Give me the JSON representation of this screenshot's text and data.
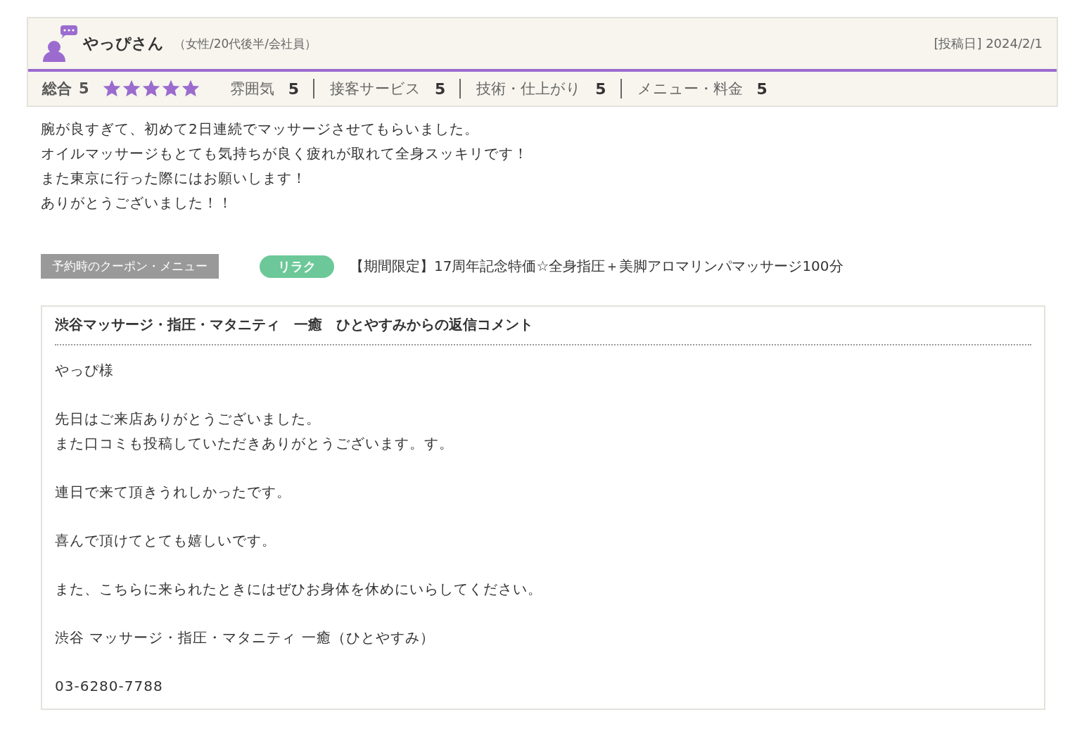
{
  "reviewer": {
    "name": "やっぴさん",
    "profile": "（女性/20代後半/会社員）",
    "posted": "[投稿日] 2024/2/1"
  },
  "overall": {
    "label": "総合",
    "score": "5",
    "stars": 5
  },
  "categories": [
    {
      "label": "雰囲気",
      "score": "5"
    },
    {
      "label": "接客サービス",
      "score": "5"
    },
    {
      "label": "技術・仕上がり",
      "score": "5"
    },
    {
      "label": "メニュー・料金",
      "score": "5"
    }
  ],
  "review_text": [
    "腕が良すぎて、初めて2日連続でマッサージさせてもらいました。",
    "オイルマッサージもとても気持ちが良く疲れが取れて全身スッキリです！",
    "また東京に行った際にはお願いします！",
    "ありがとうございました！！"
  ],
  "coupon": {
    "label": "予約時のクーポン・メニュー",
    "tag": "リラク",
    "title": "【期間限定】17周年記念特価☆全身指圧＋美脚アロマリンパマッサージ100分"
  },
  "reply": {
    "title": "渋谷マッサージ・指圧・マタニティ　一癒　ひとやすみからの返信コメント",
    "paragraphs": [
      [
        "やっぴ様"
      ],
      [
        "先日はご来店ありがとうございました。",
        "また口コミも投稿していただきありがとうございます。す。"
      ],
      [
        "連日で来て頂きうれしかったです。"
      ],
      [
        "喜んで頂けてとても嬉しいです。"
      ],
      [
        "また、こちらに来られたときにはぜひお身体を休めにいらしてください。"
      ],
      [
        "渋谷 マッサージ・指圧・マタニティ 一癒（ひとやすみ）"
      ],
      [
        "03-6280-7788"
      ]
    ]
  }
}
